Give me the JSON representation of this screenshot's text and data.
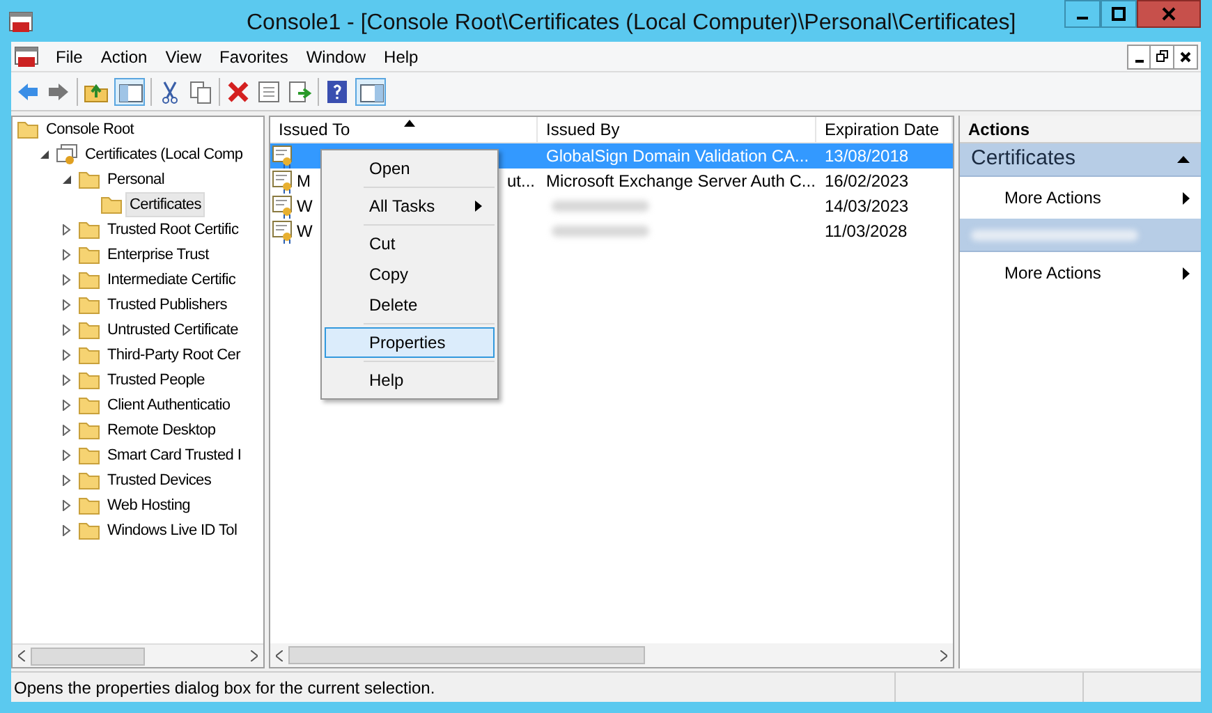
{
  "window": {
    "title": "Console1 - [Console Root\\Certificates (Local Computer)\\Personal\\Certificates]"
  },
  "menu": [
    "File",
    "Action",
    "View",
    "Favorites",
    "Window",
    "Help"
  ],
  "tree": [
    {
      "label": "Console Root",
      "selected": false,
      "children": [
        {
          "label": "Certificates (Local Comp",
          "selected": false,
          "expanded": true,
          "kind": "store",
          "children": [
            {
              "label": "Personal",
              "selected": false,
              "expanded": true,
              "children": [
                {
                  "label": "Certificates",
                  "selected": true
                }
              ]
            },
            {
              "label": "Trusted Root Certific",
              "selected": false,
              "expanded": false
            },
            {
              "label": "Enterprise Trust",
              "selected": false,
              "expanded": false
            },
            {
              "label": "Intermediate Certific",
              "selected": false,
              "expanded": false
            },
            {
              "label": "Trusted Publishers",
              "selected": false,
              "expanded": false
            },
            {
              "label": "Untrusted Certificate",
              "selected": false,
              "expanded": false
            },
            {
              "label": "Third-Party Root Cer",
              "selected": false,
              "expanded": false
            },
            {
              "label": "Trusted People",
              "selected": false,
              "expanded": false
            },
            {
              "label": "Client Authenticatio",
              "selected": false,
              "expanded": false
            },
            {
              "label": "Remote Desktop",
              "selected": false,
              "expanded": false
            },
            {
              "label": "Smart Card Trusted I",
              "selected": false,
              "expanded": false
            },
            {
              "label": "Trusted Devices",
              "selected": false,
              "expanded": false
            },
            {
              "label": "Web Hosting",
              "selected": false,
              "expanded": false
            },
            {
              "label": "Windows Live ID Tol",
              "selected": false,
              "expanded": false
            }
          ]
        }
      ]
    }
  ],
  "table": {
    "columns": [
      "Issued To",
      "Issued By",
      "Expiration Date"
    ],
    "rows": [
      {
        "issued_by": "GlobalSign Domain Validation CA...",
        "expiration": "13/08/2018",
        "selected": true
      },
      {
        "issued_to": "M",
        "issued_to_tail": "ut...",
        "issued_by": "Microsoft Exchange Server Auth C...",
        "expiration": "16/02/2023",
        "selected": false
      },
      {
        "issued_to": "W",
        "expiration": "14/03/2023",
        "selected": false
      },
      {
        "issued_to": "W",
        "expiration": "11/03/2028",
        "selected": false
      }
    ]
  },
  "context_menu": [
    {
      "kind": "item",
      "label": "Open",
      "submenu": false,
      "selected": false
    },
    {
      "kind": "separator"
    },
    {
      "kind": "item",
      "label": "All Tasks",
      "submenu": true,
      "selected": false
    },
    {
      "kind": "separator"
    },
    {
      "kind": "item",
      "label": "Cut",
      "submenu": false,
      "selected": false
    },
    {
      "kind": "item",
      "label": "Copy",
      "submenu": false,
      "selected": false
    },
    {
      "kind": "item",
      "label": "Delete",
      "submenu": false,
      "selected": false
    },
    {
      "kind": "separator"
    },
    {
      "kind": "item",
      "label": "Properties",
      "submenu": false,
      "selected": true
    },
    {
      "kind": "separator"
    },
    {
      "kind": "item",
      "label": "Help",
      "submenu": false,
      "selected": false
    }
  ],
  "actions": {
    "title": "Actions",
    "sections": [
      {
        "header": "Certificates",
        "items": [
          "More Actions"
        ]
      },
      {
        "items": [
          "More Actions"
        ]
      }
    ]
  },
  "status_bar": "Opens the properties dialog box for the current selection."
}
